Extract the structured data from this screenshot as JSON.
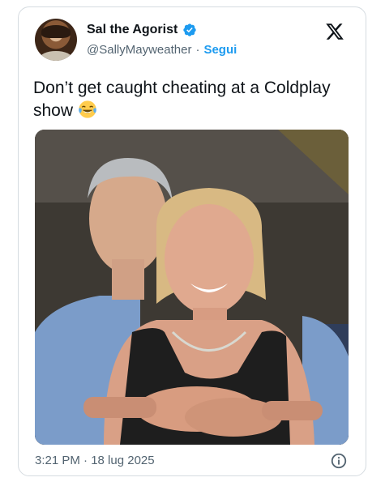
{
  "author": {
    "display_name": "Sal the Agorist",
    "handle": "@SallyMayweather",
    "separator": "·",
    "follow_label": "Segui"
  },
  "tweet": {
    "text": "Don’t get caught cheating at a Coldplay show"
  },
  "media": {
    "description_icon": "photo"
  },
  "meta": {
    "timestamp": "3:21 PM · 18 lug 2025"
  },
  "icons": {
    "verified": "verified-badge-icon",
    "x_logo": "x-logo-icon",
    "info": "info-icon",
    "emoji": "laughing-tears-emoji"
  },
  "colors": {
    "accent": "#1d9bf0",
    "text_primary": "#0f1419",
    "text_secondary": "#536471",
    "border": "#d5dbe0"
  }
}
